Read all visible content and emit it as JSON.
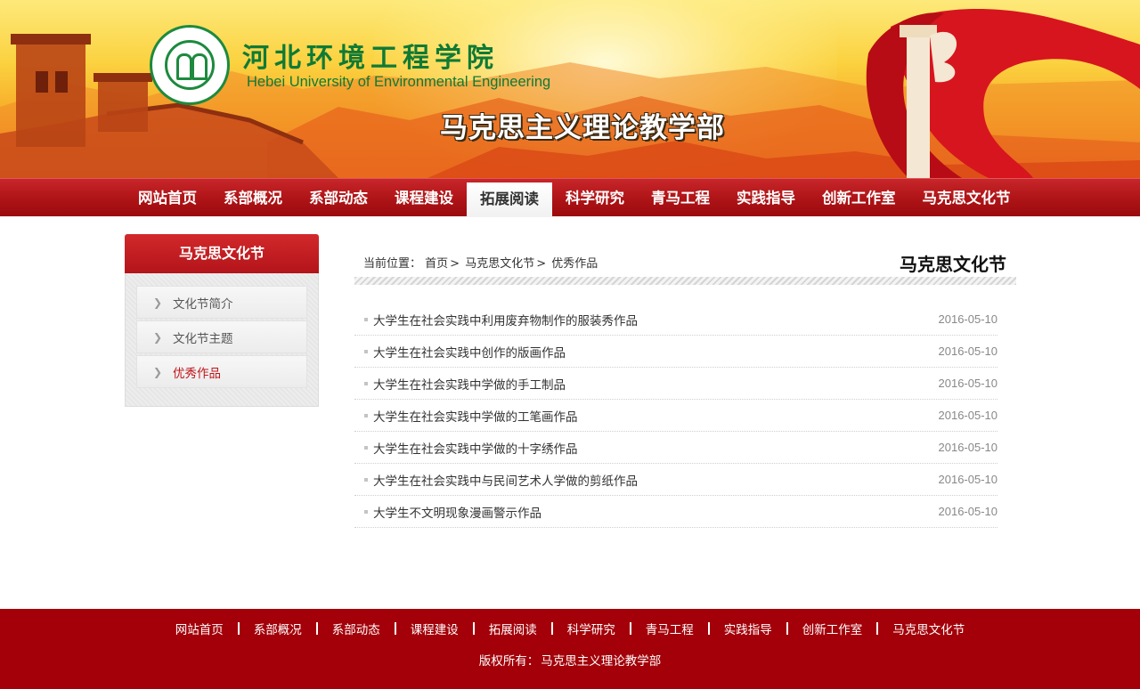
{
  "header": {
    "school_cn": "河北环境工程学院",
    "school_en": "Hebei University of Environmental Engineering",
    "department": "马克思主义理论教学部",
    "logo_icon": "school-emblem-icon"
  },
  "nav": {
    "items": [
      "网站首页",
      "系部概况",
      "系部动态",
      "课程建设",
      "拓展阅读",
      "科学研究",
      "青马工程",
      "实践指导",
      "创新工作室",
      "马克思文化节"
    ],
    "active": "拓展阅读"
  },
  "sidebar": {
    "title": "马克思文化节",
    "items": [
      {
        "label": "文化节简介"
      },
      {
        "label": "文化节主题"
      },
      {
        "label": "优秀作品"
      }
    ],
    "current": "优秀作品",
    "arrow_icon": "chevron-right-icon"
  },
  "breadcrumb": {
    "prefix": "当前位置：",
    "items": [
      "首页",
      "马克思文化节",
      "优秀作品"
    ],
    "separator": ">"
  },
  "content": {
    "section_title": "马克思文化节",
    "news": [
      {
        "title": "大学生在社会实践中利用废弃物制作的服装秀作品",
        "date": "2016-05-10"
      },
      {
        "title": "大学生在社会实践中创作的版画作品",
        "date": "2016-05-10"
      },
      {
        "title": "大学生在社会实践中学做的手工制品",
        "date": "2016-05-10"
      },
      {
        "title": "大学生在社会实践中学做的工笔画作品",
        "date": "2016-05-10"
      },
      {
        "title": "大学生在社会实践中学做的十字绣作品",
        "date": "2016-05-10"
      },
      {
        "title": "大学生在社会实践中与民间艺术人学做的剪纸作品",
        "date": "2016-05-10"
      },
      {
        "title": "大学生不文明现象漫画警示作品",
        "date": "2016-05-10"
      }
    ]
  },
  "footer": {
    "links": [
      "网站首页",
      "系部概况",
      "系部动态",
      "课程建设",
      "拓展阅读",
      "科学研究",
      "青马工程",
      "实践指导",
      "创新工作室",
      "马克思文化节"
    ],
    "copyright_label": "版权所有：",
    "copyright_owner": "马克思主义理论教学部"
  },
  "colors": {
    "brand_red": "#b01518",
    "footer_red": "#a30009",
    "school_green": "#0f7a35",
    "highlight_red": "#c0151b"
  }
}
